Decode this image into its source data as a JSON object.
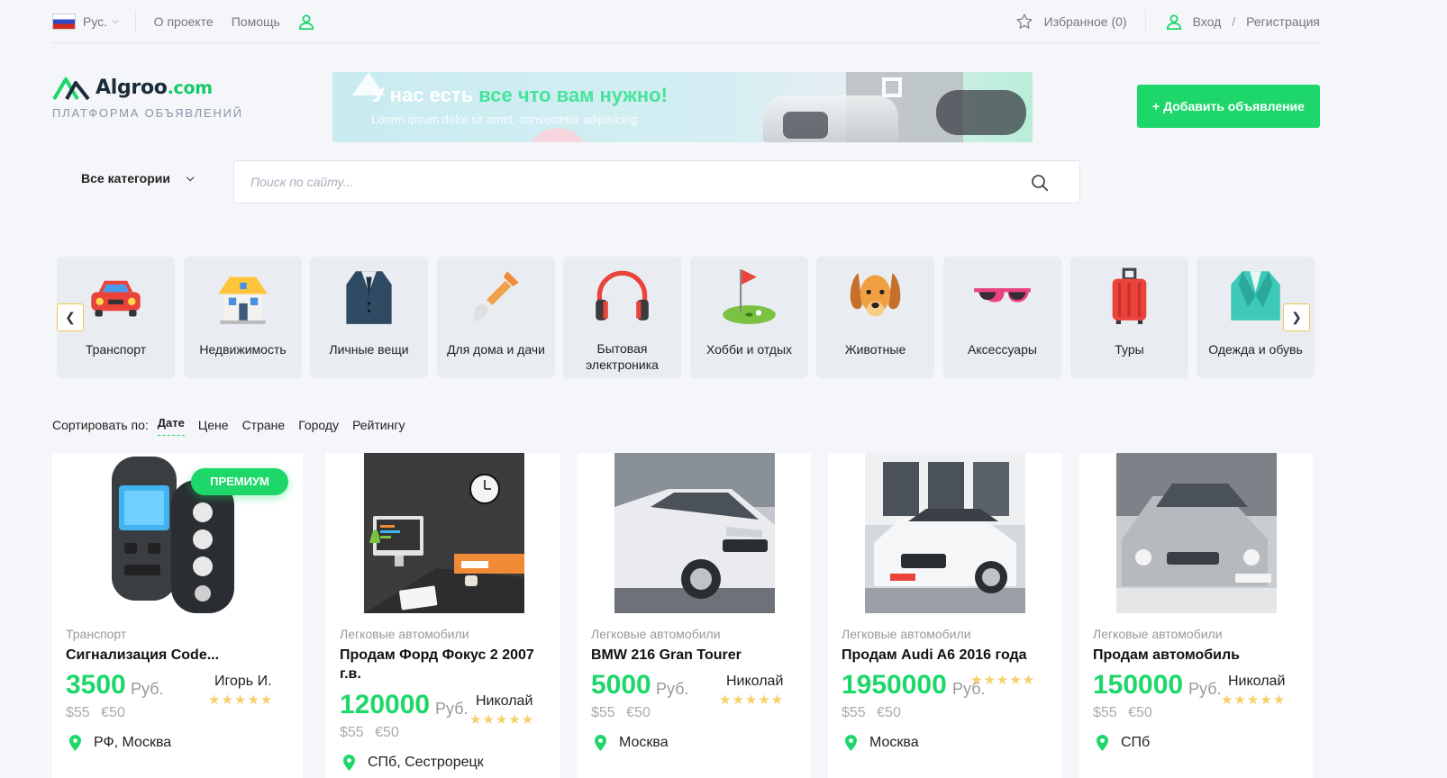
{
  "topbar": {
    "lang_label": "Рус.",
    "about_label": "О проекте",
    "help_label": "Помощь",
    "favorites_label": "Избранное (0)",
    "login_label": "Вход",
    "separator": "/",
    "register_label": "Регистрация"
  },
  "header": {
    "logo_main": "Algroo",
    "logo_domain": ".com",
    "tagline": "ПЛАТФОРМА ОБЪЯВЛЕНИЙ",
    "banner_title_a": "У нас есть",
    "banner_title_b": "все что вам нужно!",
    "banner_subtitle": "Lorem ipsum dolor sit amet, consectetur adipisicing",
    "add_button_label": "+ Добавить объявление"
  },
  "search": {
    "category_label": "Все категории",
    "placeholder": "Поиск по сайту..."
  },
  "categories": [
    {
      "label": "Транспорт",
      "icon": "car-icon"
    },
    {
      "label": "Недвижимость",
      "icon": "house-icon"
    },
    {
      "label": "Личные вещи",
      "icon": "jacket-icon"
    },
    {
      "label": "Для дома и дачи",
      "icon": "shovel-icon"
    },
    {
      "label": "Бытовая электроника",
      "icon": "headphones-icon"
    },
    {
      "label": "Хобби и отдых",
      "icon": "golf-icon"
    },
    {
      "label": "Животные",
      "icon": "dog-icon"
    },
    {
      "label": "Аксессуары",
      "icon": "sunglasses-icon"
    },
    {
      "label": "Туры",
      "icon": "suitcase-icon"
    },
    {
      "label": "Одежда и обувь",
      "icon": "blazer-icon"
    }
  ],
  "nav_prev": "❮",
  "nav_next": "❯",
  "sort": {
    "label": "Сортировать по:",
    "options": [
      "Дате",
      "Цене",
      "Стране",
      "Городу",
      "Рейтингу"
    ],
    "active": "Дате"
  },
  "listings": [
    {
      "category": "Транспорт",
      "title": "Сигнализация Code...",
      "price": "3500",
      "currency": "Руб.",
      "alt_prices": "$55 €50",
      "seller": "Игорь И.",
      "stars": "★★★★★",
      "location": "РФ, Москва",
      "badge": "ПРЕМИУМ"
    },
    {
      "category": "Легковые автомобили",
      "title": "Продам Форд Фокус 2 2007 г.в.",
      "price": "120000",
      "currency": "Руб.",
      "alt_prices": "$55 €50",
      "seller": "Николай",
      "stars": "★★★★★",
      "location": "СПб, Сестрорецк"
    },
    {
      "category": "Легковые автомобили",
      "title": "BMW 216 Gran Tourer",
      "price": "5000",
      "currency": "Руб.",
      "alt_prices": "$55 €50",
      "seller": "Николай",
      "stars": "★★★★★",
      "location": "Москва"
    },
    {
      "category": "Легковые автомобили",
      "title": "Продам Audi A6 2016 года",
      "price": "1950000",
      "currency": "Руб.",
      "alt_prices": "$55 €50",
      "seller": "",
      "stars": "★★★★★",
      "location": "Москва"
    },
    {
      "category": "Легковые автомобили",
      "title": "Продам автомобиль",
      "price": "150000",
      "currency": "Руб.",
      "alt_prices": "$55 €50",
      "seller": "Николай",
      "stars": "★★★★★",
      "location": "СПб"
    }
  ],
  "colors": {
    "accent": "#1ed76a",
    "star": "#f5d06b",
    "background": "#f4f6f9"
  }
}
